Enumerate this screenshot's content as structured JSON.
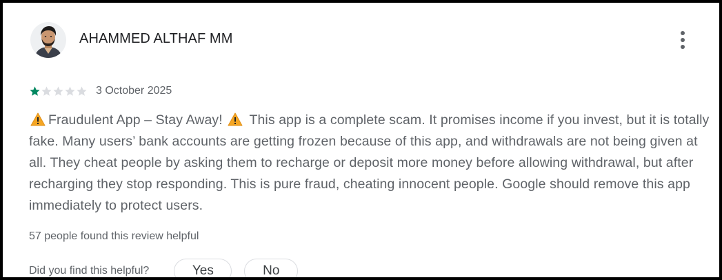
{
  "review": {
    "reviewer_name": "AHAMMED ALTHAF MM",
    "rating": 1,
    "max_rating": 5,
    "date": "3 October 2025",
    "body": {
      "title": "Fraudulent App – Stay Away!",
      "text": "This app is a complete scam. It promises income if you invest, but it is totally fake. Many users’ bank accounts are getting frozen because of this app, and withdrawals are not being given at all. They cheat people by asking them to recharge or deposit more money before allowing withdrawal, but after recharging they stop responding. This is pure fraud, cheating innocent people. Google should remove this app immediately to protect users."
    },
    "helpful_count_text": "57 people found this review helpful",
    "helpful_question": "Did you find this helpful?",
    "yes_label": "Yes",
    "no_label": "No"
  },
  "icons": {
    "avatar": "avatar-photo",
    "menu": "more-vert-icon",
    "star_filled": "star-filled-icon",
    "star_empty": "star-empty-icon",
    "warning": "warning-icon"
  },
  "colors": {
    "star_filled": "#01875f",
    "star_empty": "#dadce0",
    "text_primary": "#202124",
    "text_secondary": "#5f6368",
    "warning": "#f5a623"
  }
}
